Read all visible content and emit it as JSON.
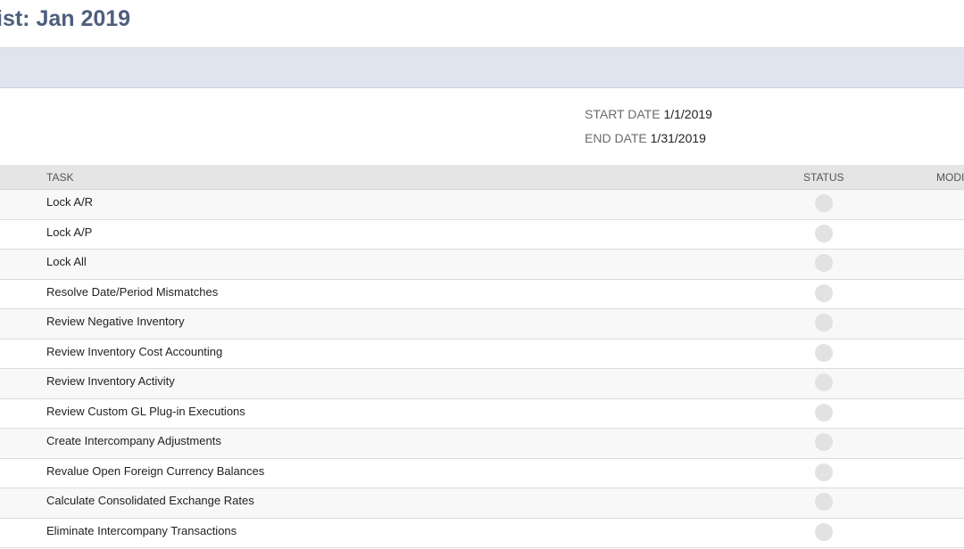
{
  "page": {
    "title": "ist: Jan 2019"
  },
  "period": {
    "start_label": "START DATE",
    "start_value": "1/1/2019",
    "end_label": "END DATE",
    "end_value": "1/31/2019"
  },
  "table": {
    "headers": {
      "task": "TASK",
      "status": "STATUS",
      "modified": "MODI"
    },
    "rows": [
      {
        "task": "Lock A/R",
        "status": "not-started"
      },
      {
        "task": "Lock A/P",
        "status": "not-started"
      },
      {
        "task": "Lock All",
        "status": "not-started"
      },
      {
        "task": "Resolve Date/Period Mismatches",
        "status": "not-started"
      },
      {
        "task": "Review Negative Inventory",
        "status": "not-started"
      },
      {
        "task": "Review Inventory Cost Accounting",
        "status": "not-started"
      },
      {
        "task": "Review Inventory Activity",
        "status": "not-started"
      },
      {
        "task": "Review Custom GL Plug-in Executions",
        "status": "not-started"
      },
      {
        "task": "Create Intercompany Adjustments",
        "status": "not-started"
      },
      {
        "task": "Revalue Open Foreign Currency Balances",
        "status": "not-started"
      },
      {
        "task": "Calculate Consolidated Exchange Rates",
        "status": "not-started"
      },
      {
        "task": "Eliminate Intercompany Transactions",
        "status": "not-started"
      }
    ]
  },
  "colors": {
    "title": "#4d5f7c",
    "bar": "#dfe4ee",
    "status_dot": "#e2e2e2"
  }
}
